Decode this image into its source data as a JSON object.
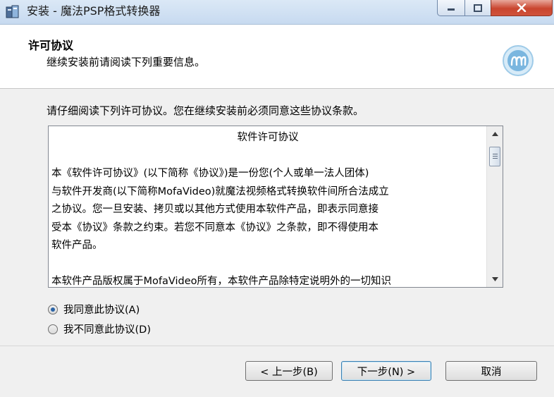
{
  "window": {
    "title": "安装 - 魔法PSP格式转换器"
  },
  "header": {
    "title": "许可协议",
    "subtitle": "继续安装前请阅读下列重要信息。"
  },
  "instruction": "请仔细阅读下列许可协议。您在继续安装前必须同意这些协议条款。",
  "license": {
    "heading": "软件许可协议",
    "para1_lines": [
      "本《软件许可协议》(以下简称《协议》)是一份您(个人或单一法人团体)",
      "与软件开发商(以下简称MofaVideo)就魔法视频格式转换软件间所合法成立",
      "之协议。您一旦安装、拷贝或以其他方式使用本软件产品，即表示同意接",
      "受本《协议》条款之约束。若您不同意本《协议》之条款，即不得使用本",
      "软件产品。"
    ],
    "para2_lines": [
      "本软件产品版权属于MofaVideo所有，本软件产品除特定说明外的一切知识"
    ]
  },
  "options": {
    "agree": "我同意此协议(A)",
    "disagree": "我不同意此协议(D)",
    "selected": "agree"
  },
  "buttons": {
    "back": "< 上一步(B)",
    "next": "下一步(N) >",
    "cancel": "取消"
  },
  "colors": {
    "radio_dot": "#2b64a6",
    "close_button": "#c9452f",
    "logo": "#7ab6df"
  }
}
